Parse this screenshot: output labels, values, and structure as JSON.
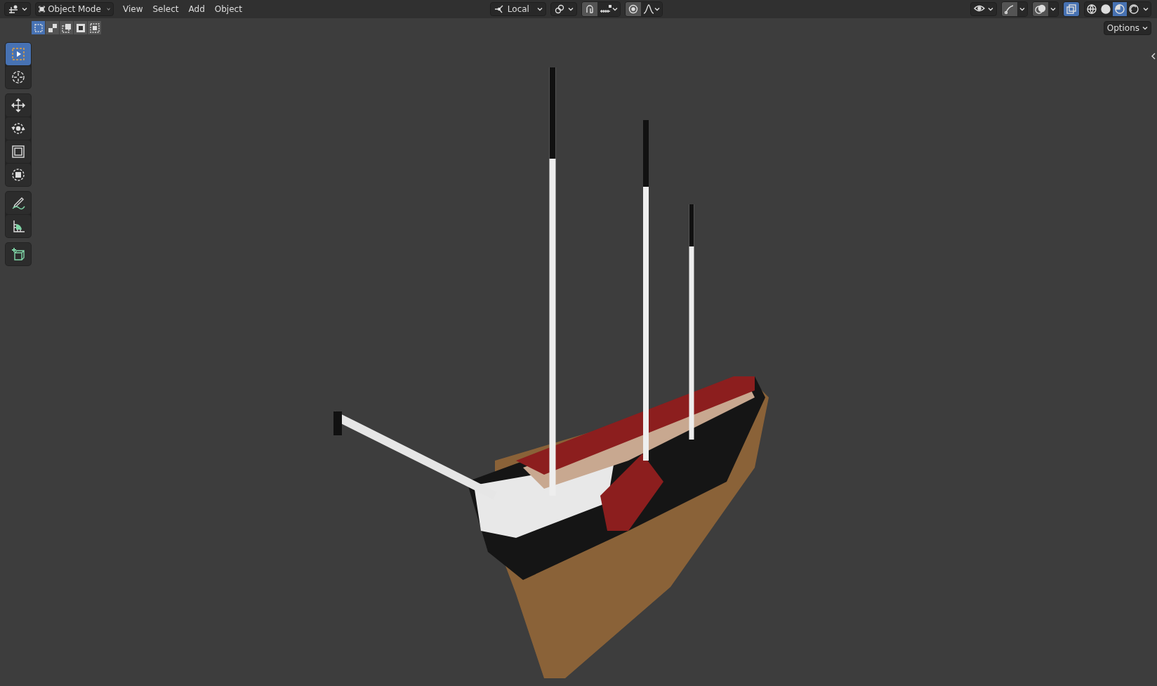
{
  "header": {
    "mode": {
      "label": "Object Mode"
    },
    "menus": [
      "View",
      "Select",
      "Add",
      "Object"
    ],
    "transform_orientation": {
      "label": "Local"
    },
    "snap": {
      "on": true
    },
    "proportional_editing": {
      "on": true
    },
    "xray": {
      "on": true
    },
    "shading_modes": [
      {
        "kind": "wireframe",
        "selected": false
      },
      {
        "kind": "solid",
        "selected": false
      },
      {
        "kind": "material",
        "selected": true
      },
      {
        "kind": "rendered",
        "selected": false
      }
    ],
    "options": {
      "label": "Options"
    }
  },
  "select_modes": [
    {
      "kind": "new",
      "selected": true
    },
    {
      "kind": "extend",
      "selected": false
    },
    {
      "kind": "subtract",
      "selected": false
    },
    {
      "kind": "invert",
      "selected": false
    },
    {
      "kind": "intersect",
      "selected": false
    }
  ],
  "tool_groups": [
    {
      "tools": [
        {
          "kind": "select-box",
          "selected": true
        },
        {
          "kind": "cursor",
          "selected": false
        }
      ]
    },
    {
      "tools": [
        {
          "kind": "move",
          "selected": false
        },
        {
          "kind": "rotate",
          "selected": false
        },
        {
          "kind": "scale",
          "selected": false
        },
        {
          "kind": "transform",
          "selected": false
        }
      ]
    },
    {
      "tools": [
        {
          "kind": "annotate",
          "selected": false
        },
        {
          "kind": "measure",
          "selected": false
        }
      ]
    },
    {
      "tools": [
        {
          "kind": "add-cube",
          "selected": false
        }
      ]
    }
  ]
}
